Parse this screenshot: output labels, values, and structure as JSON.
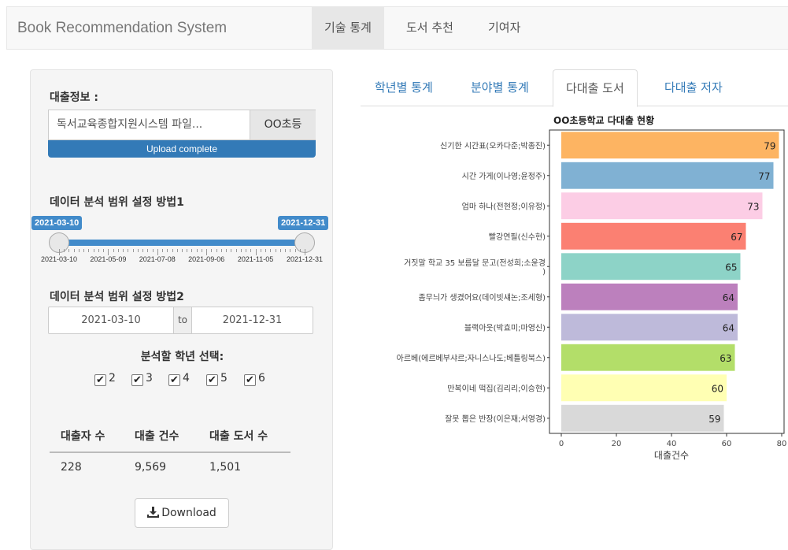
{
  "navbar": {
    "brand": "Book Recommendation System",
    "items": [
      {
        "label": "기술 통계",
        "active": true
      },
      {
        "label": "도서 추천",
        "active": false
      },
      {
        "label": "기여자",
        "active": false
      }
    ]
  },
  "sidebar": {
    "loan_info_label": "대출정보 :",
    "file_name": "독서교육종합지원시스템 파일...",
    "file_button": "OO초등",
    "upload_status": "Upload complete",
    "range1_label": "데이터 분석 범위 설정 방법1",
    "slider": {
      "from": "2021-03-10",
      "to": "2021-12-31",
      "tick_labels": [
        "2021-03-10",
        "2021-05-09",
        "2021-07-08",
        "2021-09-06",
        "2021-11-05",
        "2021-12-31"
      ]
    },
    "range2_label": "데이터 분석 범위 설정 방법2",
    "date_start": "2021-03-10",
    "date_sep": "to",
    "date_end": "2021-12-31",
    "grade_title": "분석할 학년 선택:",
    "grades": [
      {
        "label": "2",
        "checked": true
      },
      {
        "label": "3",
        "checked": true
      },
      {
        "label": "4",
        "checked": true
      },
      {
        "label": "5",
        "checked": true
      },
      {
        "label": "6",
        "checked": true
      }
    ],
    "stats": {
      "headers": [
        "대출자 수",
        "대출 건수",
        "대출 도서 수"
      ],
      "values": [
        "228",
        "9,569",
        "1,501"
      ]
    },
    "download_label": "Download"
  },
  "tabs": [
    {
      "label": "학년별 통계",
      "active": false
    },
    {
      "label": "분야별 통계",
      "active": false
    },
    {
      "label": "다대출 도서",
      "active": true
    },
    {
      "label": "다대출 저자",
      "active": false
    }
  ],
  "chart_data": {
    "type": "bar",
    "title": "OO초등학교 다대출 현황",
    "xlabel": "대출건수",
    "xlim": [
      0,
      80
    ],
    "xticks": [
      0,
      20,
      40,
      60,
      80
    ],
    "orientation": "horizontal",
    "categories": [
      "신기한 시간표(오카다준;박종진)",
      "시간 가게(이나영;윤정주)",
      "엄마 하나(전현정;이유정)",
      "빨강연필(신수현)",
      "거짓말 학교 35 보름달 문고(전성희;소윤경)",
      "좀무늬가 생겼어요(데이빗섀논;조세형)",
      "블랙아웃(박효미;마영신)",
      "아르베(에르베부샤르;자니스나도;베틀링북스)",
      "만복이네 떡집(김리리;이승현)",
      "잘못 뽑은 반장(이은재;서영경)"
    ],
    "values": [
      79,
      77,
      73,
      67,
      65,
      64,
      64,
      63,
      60,
      59
    ],
    "colors": [
      "#FDB462",
      "#80B1D3",
      "#FCCDE5",
      "#FB8072",
      "#8DD3C7",
      "#BC80BD",
      "#BEBADA",
      "#B3DE69",
      "#FFFFB3",
      "#D9D9D9"
    ]
  }
}
